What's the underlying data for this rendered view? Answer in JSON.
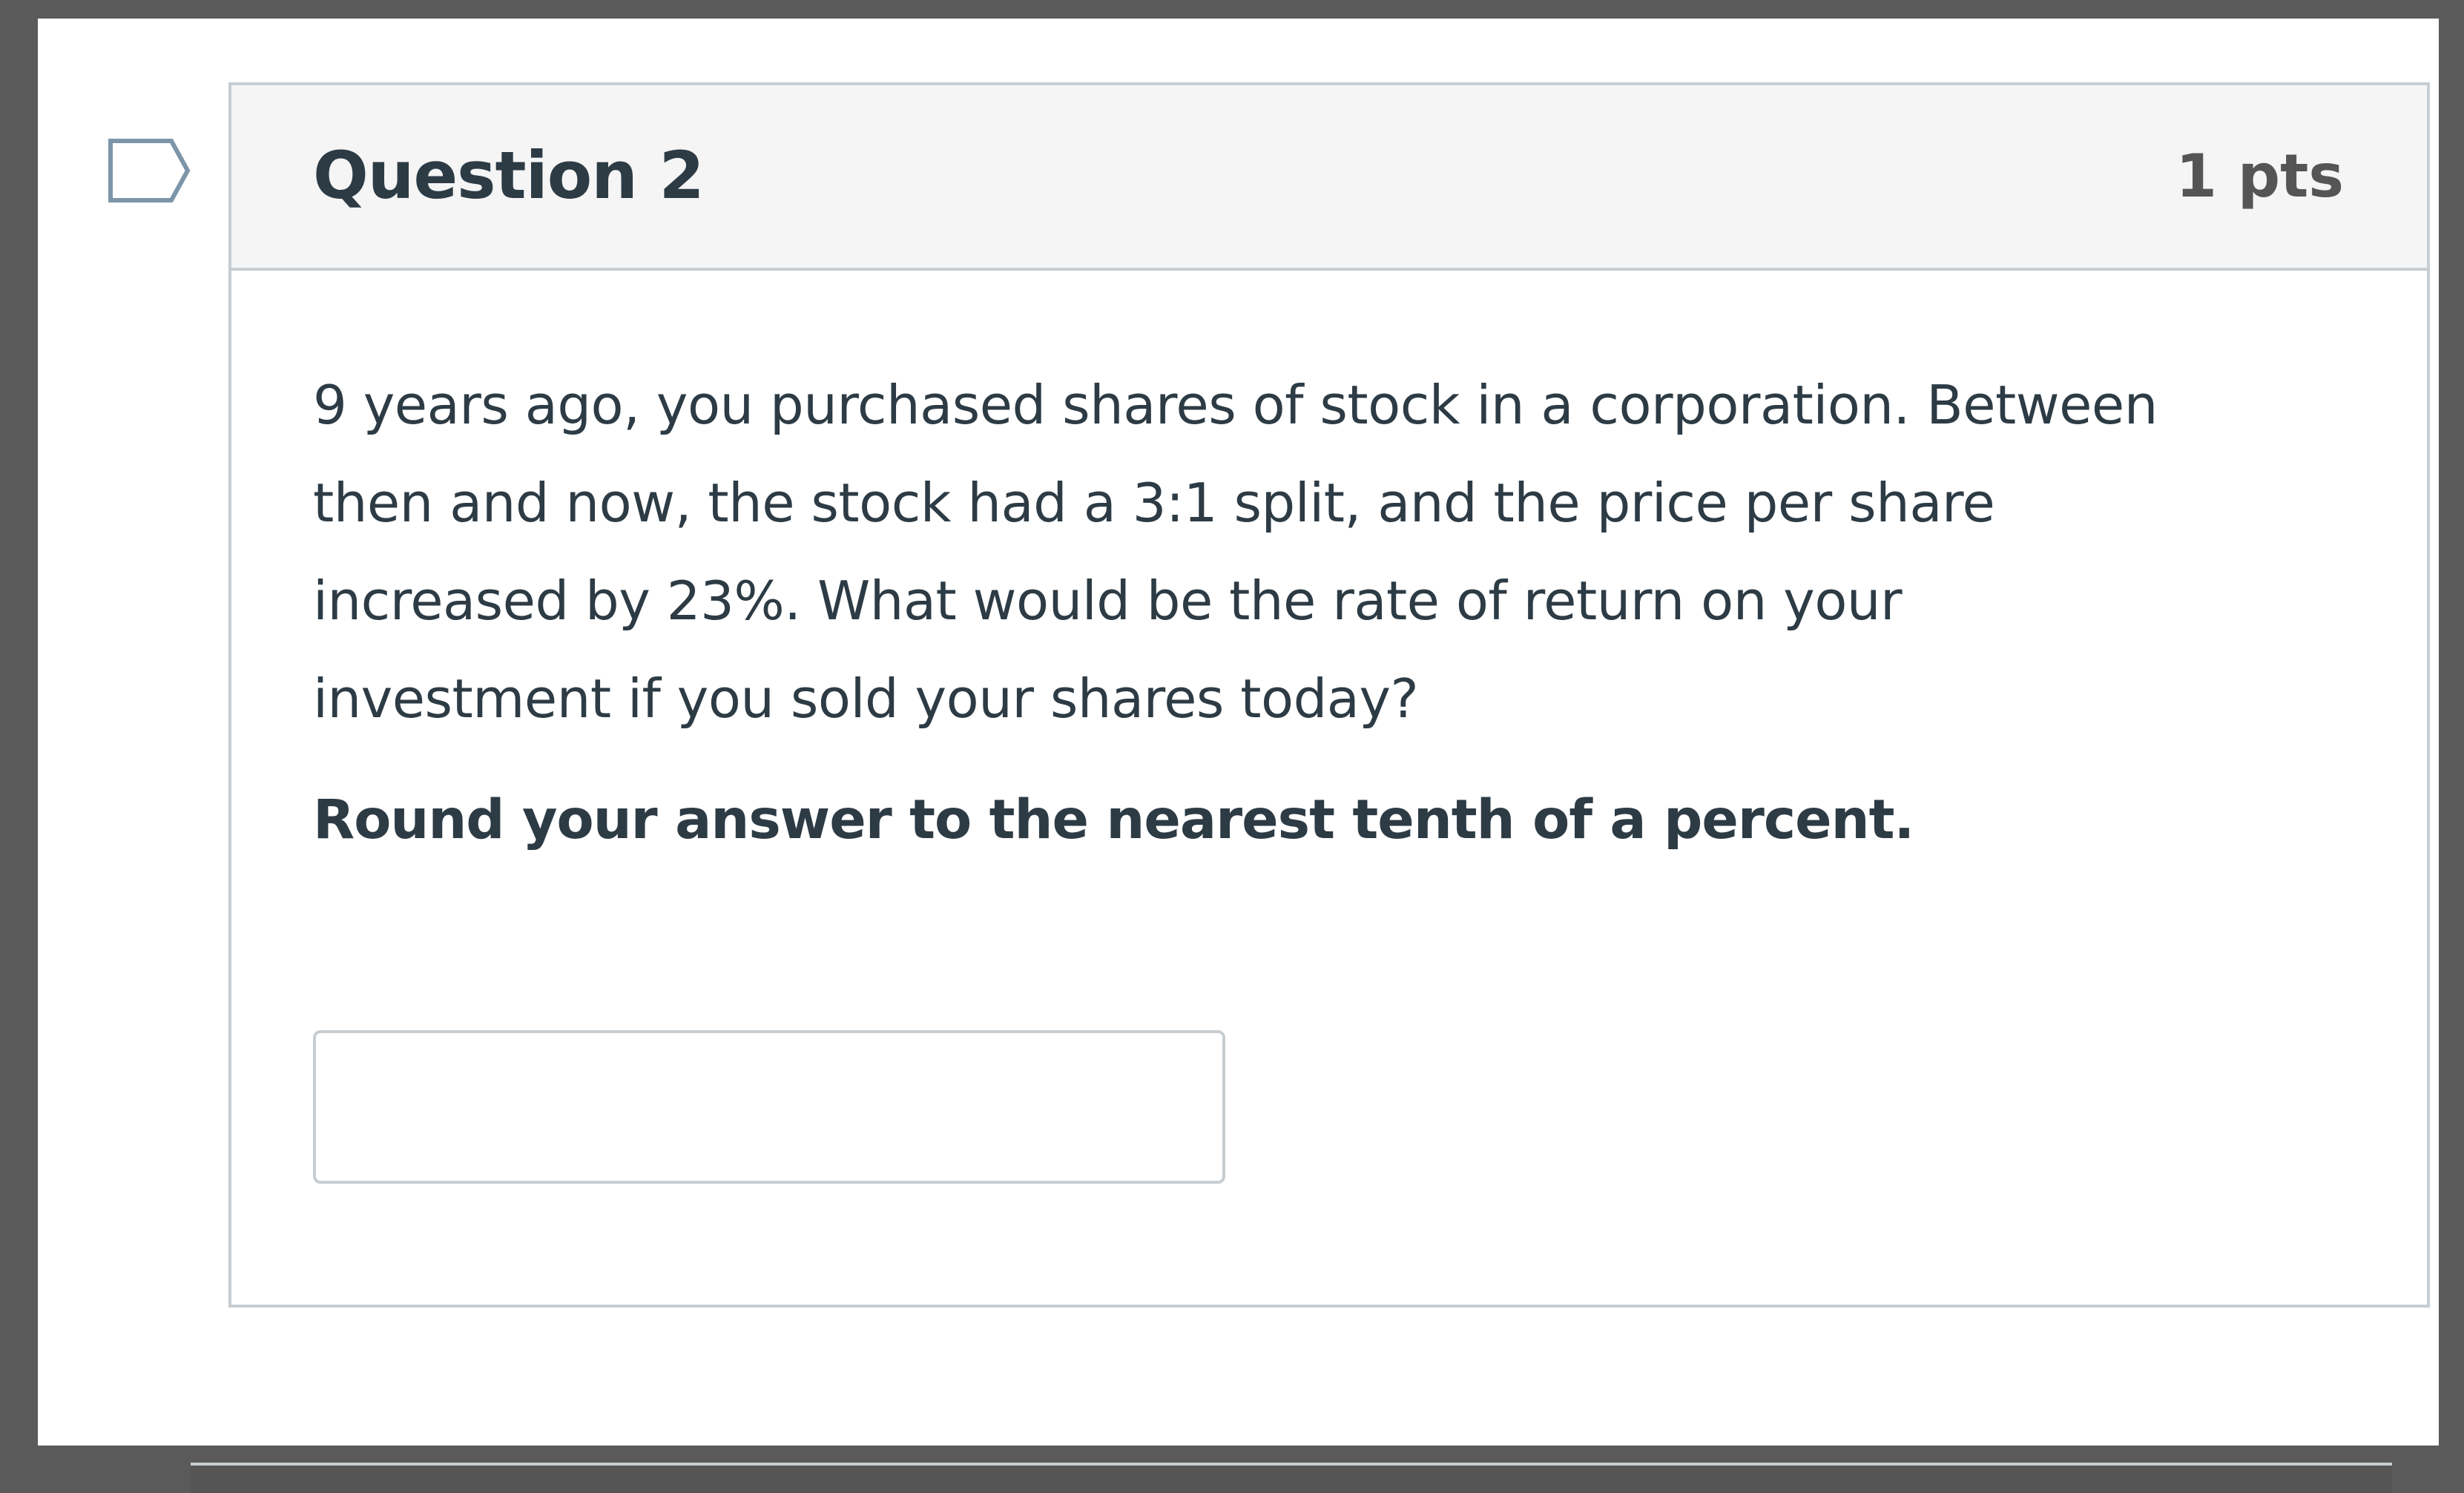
{
  "question": {
    "title": "Question 2",
    "points": "1 pts",
    "text_lines": [
      "9 years ago, you purchased shares of stock in a corporation. Between",
      "then and now, the stock had a 3:1 split, and the price per share",
      "increased by 23%. What would be the rate of return on your",
      "investment if you sold your shares today?"
    ],
    "instruction": "Round your answer to the nearest tenth of a percent.",
    "answer_value": "",
    "flag_icon": "flag-outline-icon"
  },
  "colors": {
    "background": "#5a5a5a",
    "page": "#ffffff",
    "header_bg": "#f5f5f5",
    "border": "#c7cdd1",
    "text": "#2d3b45",
    "points_text": "#555555",
    "flag_stroke": "#7c95a8"
  }
}
